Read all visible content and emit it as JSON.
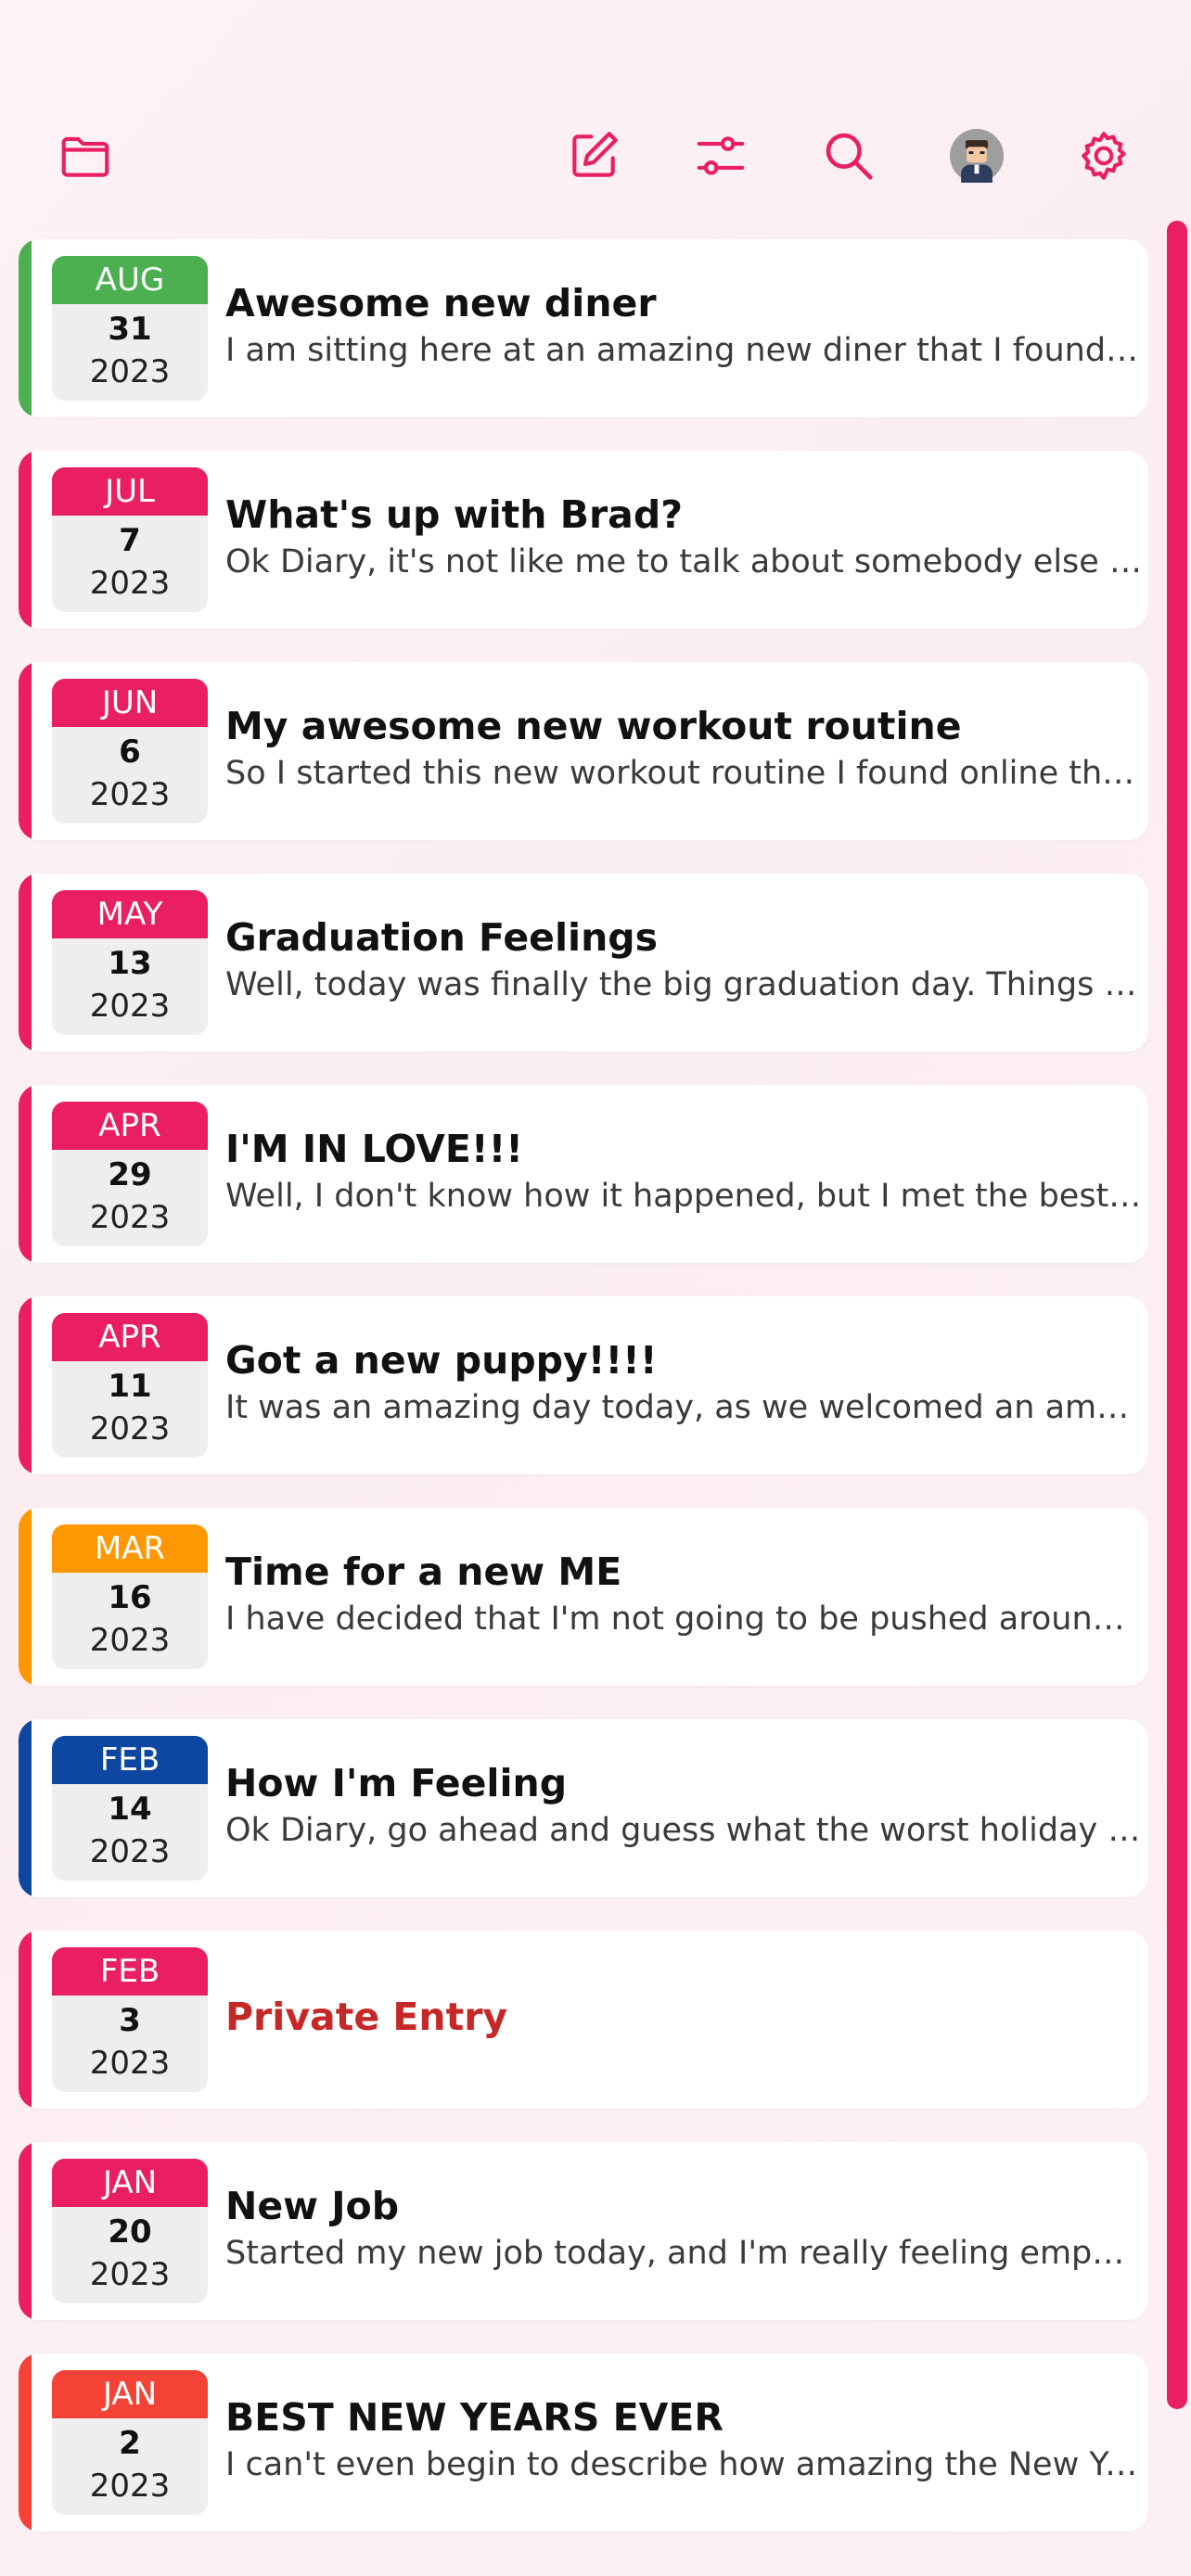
{
  "colors": {
    "accent": "#e91e63"
  },
  "toolbar": {
    "icons": [
      "folder-icon",
      "edit-icon",
      "filter-sliders-icon",
      "search-icon",
      "avatar",
      "gear-icon"
    ]
  },
  "entries": [
    {
      "month": "AUG",
      "day": "31",
      "year": "2023",
      "title": "Awesome new diner",
      "snippet": "I am sitting here at an amazing new diner that I found! T...",
      "color": "#4caf50"
    },
    {
      "month": "JUL",
      "day": "7",
      "year": "2023",
      "title": "What's up with Brad?",
      "snippet": "Ok Diary, it's not like me to talk about somebody else in ...",
      "color": "#e91e63"
    },
    {
      "month": "JUN",
      "day": "6",
      "year": "2023",
      "title": "My awesome new workout routine",
      "snippet": "So I started this new workout routine I found online this ...",
      "color": "#e91e63"
    },
    {
      "month": "MAY",
      "day": "13",
      "year": "2023",
      "title": "Graduation Feelings",
      "snippet": "Well, today was finally the big graduation day. Things ar...",
      "color": "#e91e63"
    },
    {
      "month": "APR",
      "day": "29",
      "year": "2023",
      "title": "I'M IN LOVE!!!",
      "snippet": "Well, I don't know how it happened, but I met the best g...",
      "color": "#e91e63"
    },
    {
      "month": "APR",
      "day": "11",
      "year": "2023",
      "title": "Got a new puppy!!!!",
      "snippet": "It was an amazing day today, as we welcomed an amazin...",
      "color": "#e91e63"
    },
    {
      "month": "MAR",
      "day": "16",
      "year": "2023",
      "title": "Time for a new ME",
      "snippet": "I have decided that I'm not going to be pushed around a...",
      "color": "#ff9800"
    },
    {
      "month": "FEB",
      "day": "14",
      "year": "2023",
      "title": "How I'm Feeling",
      "snippet": "Ok Diary, go ahead and guess what the worst holiday of ...",
      "color": "#0d47a1"
    },
    {
      "month": "FEB",
      "day": "3",
      "year": "2023",
      "title": "Private Entry",
      "snippet": "",
      "color": "#e91e63",
      "private": true
    },
    {
      "month": "JAN",
      "day": "20",
      "year": "2023",
      "title": "New Job",
      "snippet": "Started my new job today, and I'm really feeling empowe...",
      "color": "#e91e63"
    },
    {
      "month": "JAN",
      "day": "2",
      "year": "2023",
      "title": "BEST NEW YEARS EVER",
      "snippet": "I can't even begin to describe how amazing the New Yea...",
      "color": "#f44336"
    }
  ]
}
